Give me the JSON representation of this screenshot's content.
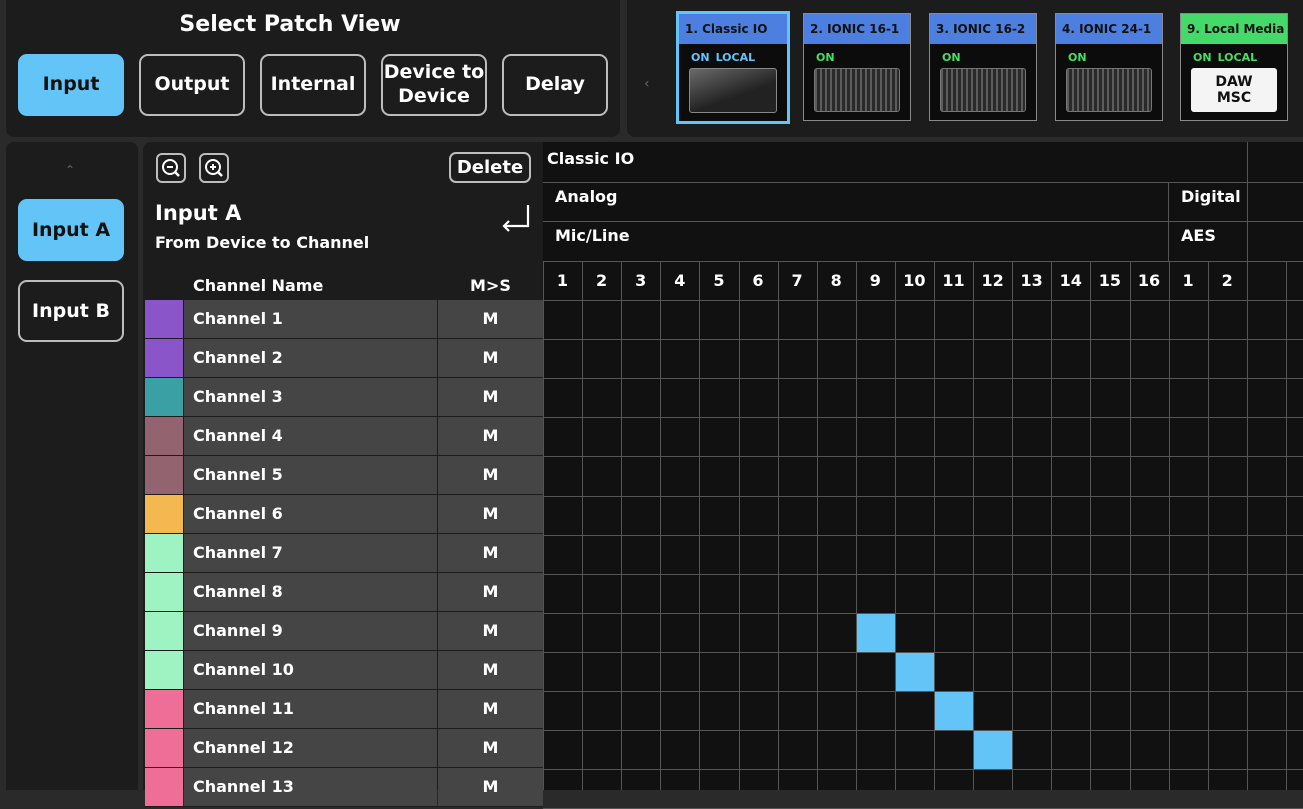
{
  "view_selector": {
    "title": "Select Patch View",
    "buttons": [
      "Input",
      "Output",
      "Internal",
      "Device to\nDevice",
      "Delay"
    ],
    "active": "Input"
  },
  "devices": [
    {
      "label": "1. Classic IO",
      "status": "ON",
      "local": "LOCAL",
      "art": "desk",
      "header": "blue",
      "selected": true
    },
    {
      "label": "2. IONIC 16-1",
      "status": "ON",
      "local": "",
      "art": "rack",
      "header": "blue",
      "selected": false
    },
    {
      "label": "3. IONIC 16-2",
      "status": "ON",
      "local": "",
      "art": "rack",
      "header": "blue",
      "selected": false
    },
    {
      "label": "4. IONIC 24-1",
      "status": "ON",
      "local": "",
      "art": "rack",
      "header": "blue",
      "selected": false
    },
    {
      "label": "9. Local Media",
      "status": "ON",
      "local": "LOCAL",
      "art": "daw",
      "art_text": "DAW\nMSC",
      "header": "green",
      "selected": false
    }
  ],
  "strip_arrow": "‹",
  "sidebar": {
    "up_arrow": "⌃",
    "items": [
      {
        "label": "Input A",
        "active": true
      },
      {
        "label": "Input B",
        "active": false
      }
    ]
  },
  "panel": {
    "delete_label": "Delete",
    "title": "Input A",
    "subtitle": "From Device to Channel",
    "col_name": "Channel Name",
    "col_ms": "M>S"
  },
  "channels": [
    {
      "name": "Channel 1",
      "ms": "M",
      "color": "#8a55c9"
    },
    {
      "name": "Channel 2",
      "ms": "M",
      "color": "#8a55c9"
    },
    {
      "name": "Channel 3",
      "ms": "M",
      "color": "#3aa0a4"
    },
    {
      "name": "Channel 4",
      "ms": "M",
      "color": "#936370"
    },
    {
      "name": "Channel 5",
      "ms": "M",
      "color": "#936370"
    },
    {
      "name": "Channel 6",
      "ms": "M",
      "color": "#f3b850"
    },
    {
      "name": "Channel 7",
      "ms": "M",
      "color": "#9ef3c2"
    },
    {
      "name": "Channel 8",
      "ms": "M",
      "color": "#9ef3c2"
    },
    {
      "name": "Channel 9",
      "ms": "M",
      "color": "#9ef3c2"
    },
    {
      "name": "Channel 10",
      "ms": "M",
      "color": "#9ef3c2"
    },
    {
      "name": "Channel 11",
      "ms": "M",
      "color": "#ee6e98"
    },
    {
      "name": "Channel 12",
      "ms": "M",
      "color": "#ee6e98"
    },
    {
      "name": "Channel 13",
      "ms": "M",
      "color": "#ee6e98"
    }
  ],
  "matrix": {
    "device": "Classic IO",
    "group": "Analog",
    "subgroup": "Mic/Line",
    "digital_group": "Digital",
    "digital_subgroup": "AES",
    "analog_numbers": [
      "1",
      "2",
      "3",
      "4",
      "5",
      "6",
      "7",
      "8",
      "9",
      "10",
      "11",
      "12",
      "13",
      "14",
      "15",
      "16"
    ],
    "digital_numbers": [
      "1",
      "2"
    ],
    "patches": [
      {
        "channel": 9,
        "input": 9
      },
      {
        "channel": 10,
        "input": 10
      },
      {
        "channel": 11,
        "input": 11
      },
      {
        "channel": 12,
        "input": 12
      }
    ],
    "accent": "#63c4f7"
  }
}
